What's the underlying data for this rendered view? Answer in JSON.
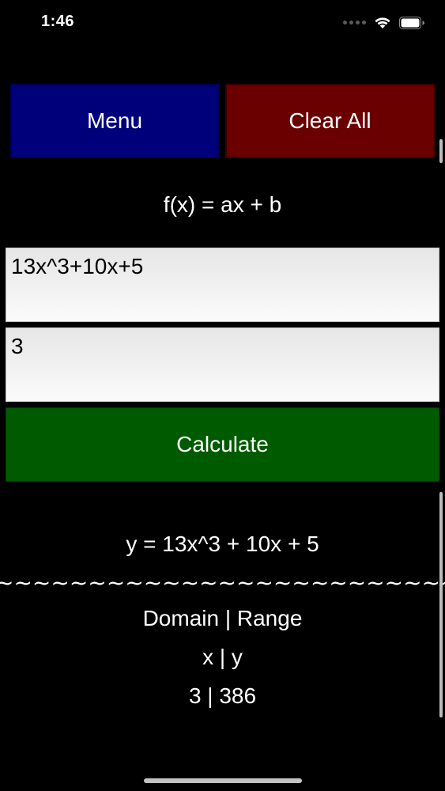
{
  "status_bar": {
    "time": "1:46"
  },
  "toolbar": {
    "menu_label": "Menu",
    "clear_label": "Clear All",
    "menu_color": "#00007a",
    "clear_color": "#6a0000"
  },
  "formula": {
    "template": "f(x) = ax + b"
  },
  "inputs": {
    "expression_value": "13x^3+10x+5",
    "x_value": "3"
  },
  "calculate": {
    "label": "Calculate",
    "color": "#005a00"
  },
  "result": {
    "equation": "y = 13x^3 + 10x + 5",
    "separator": "~~~~~~~~~~~~~~~~~~~~~~~~~~~~~~~~~~~~~~",
    "table_title": "Domain | Range",
    "table_header": "x | y",
    "rows": [
      "3 | 386"
    ]
  },
  "icons": [
    "wifi-icon",
    "battery-icon",
    "signal-dots-icon"
  ]
}
